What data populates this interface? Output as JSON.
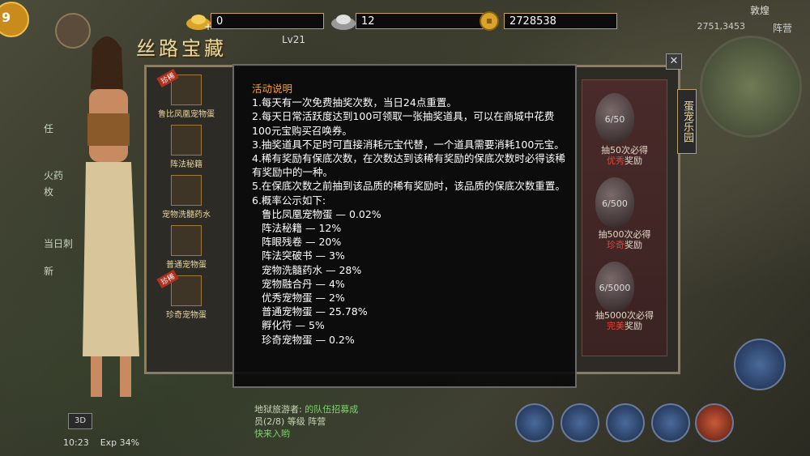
{
  "currency": {
    "gold": "0",
    "silver": "12",
    "coins": "2728538"
  },
  "hud": {
    "level_badge": "9",
    "player_level": "Lv21",
    "map_name": "敦煌",
    "map_coord": "2751,3453",
    "camp": "阵营",
    "time": "10:23",
    "exp": "Exp 34%",
    "btn_3d": "3D"
  },
  "title": "丝路宝藏",
  "items": [
    {
      "name": "鲁比凤凰宠物蛋",
      "tag": "珍稀"
    },
    {
      "name": "阵法秘籍",
      "tag": ""
    },
    {
      "name": "宠物洗髓药水",
      "tag": ""
    },
    {
      "name": "普通宠物蛋",
      "tag": ""
    },
    {
      "name": "珍奇宠物蛋",
      "tag": "珍稀"
    }
  ],
  "eggs": [
    {
      "count": "6/50",
      "line1": "抽50次必得",
      "quality": "优秀",
      "line2": "奖励"
    },
    {
      "count": "6/500",
      "line1": "抽500次必得",
      "quality": "珍奇",
      "line2": "奖励"
    },
    {
      "count": "6/5000",
      "line1": "抽5000次必得",
      "quality": "完美",
      "line2": "奖励"
    }
  ],
  "side_tab": "蛋宠乐园",
  "quest_lines": [
    "任",
    "火药",
    "枚",
    "当日刺",
    "新"
  ],
  "chat": {
    "line1_prefix": "地狱旅游者: ",
    "line1_rest": "的队伍招募成",
    "line2": "员(2/8)  等级 阵营",
    "line3": "快来入哟"
  },
  "popup": {
    "heading": "活动说明",
    "rules": [
      "1.每天有一次免费抽奖次数，当日24点重置。",
      "2.每天日常活跃度达到100可领取一张抽奖道具，可以在商城中花费100元宝购买召唤券。",
      "3.抽奖道具不足时可直接消耗元宝代替，一个道具需要消耗100元宝。",
      "4.稀有奖励有保底次数，在次数达到该稀有奖励的保底次数时必得该稀有奖励中的一种。",
      "5.在保底次数之前抽到该品质的稀有奖励时，该品质的保底次数重置。",
      "6.概率公示如下:"
    ],
    "probabilities": [
      "鲁比凤凰宠物蛋 — 0.02%",
      "阵法秘籍 — 12%",
      "阵眼残卷 — 20%",
      "阵法突破书 — 3%",
      "宠物洗髓药水 — 28%",
      "宠物融合丹 — 4%",
      "优秀宠物蛋 — 2%",
      "普通宠物蛋 — 25.78%",
      "孵化符 — 5%",
      "珍奇宠物蛋 — 0.2%"
    ]
  },
  "colors": {
    "heading": "#f3a22a",
    "gold_border": "#c9a14a",
    "highlight_red": "#e0483a"
  }
}
